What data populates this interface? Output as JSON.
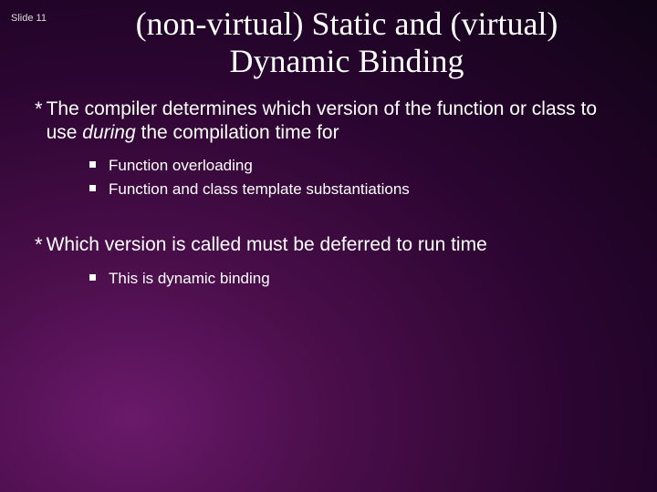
{
  "slide_number": "Slide 11",
  "title_line1": "(non-virtual) Static and (virtual)",
  "title_line2": "Dynamic Binding",
  "b1_pre": "The compiler determines which version of the function or class to use ",
  "b1_italic": "during",
  "b1_post": " the compilation time for",
  "b1_sub1": "Function overloading",
  "b1_sub2": "Function and class template substantiations",
  "b2": "Which version is called must be deferred to run time",
  "b2_sub1": "This is dynamic binding"
}
